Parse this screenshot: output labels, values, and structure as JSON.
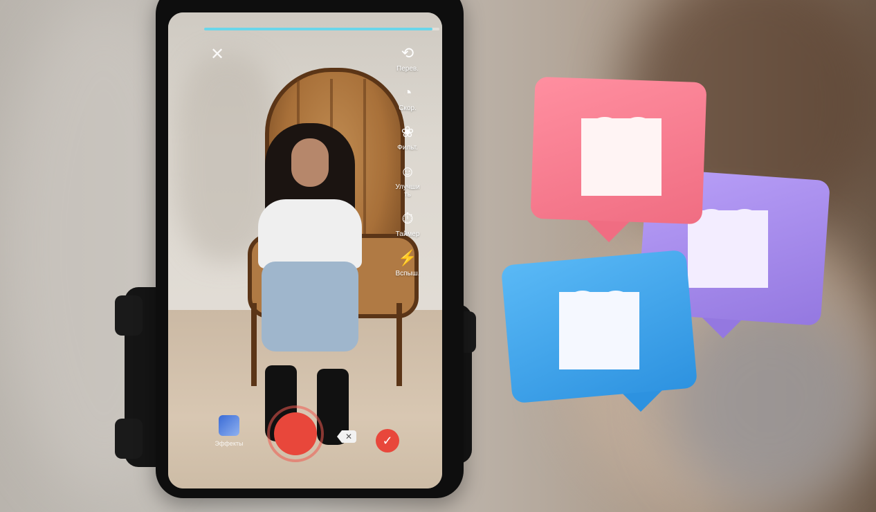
{
  "camera": {
    "recording_progress": 0.97,
    "close_icon": "close-icon",
    "tools": [
      {
        "icon": "flip-camera-icon",
        "label": "Перев."
      },
      {
        "icon": "speed-icon",
        "label": "Скор."
      },
      {
        "icon": "filters-icon",
        "label": "Фильт."
      },
      {
        "icon": "beautify-icon",
        "label": "Улучши\nть"
      },
      {
        "icon": "timer-icon",
        "label": "Таймер"
      },
      {
        "icon": "flash-icon",
        "label": "Вспыш."
      }
    ],
    "effects_label": "Эффекты",
    "record_color": "#e8473b",
    "confirm_icon": "check-icon",
    "delete_icon": "backspace-icon"
  },
  "like_bubbles": [
    {
      "color": "#fb7b8e",
      "icon": "heart-icon"
    },
    {
      "color": "#a88bf0",
      "icon": "heart-icon"
    },
    {
      "color": "#3aa3ee",
      "icon": "heart-icon"
    }
  ]
}
